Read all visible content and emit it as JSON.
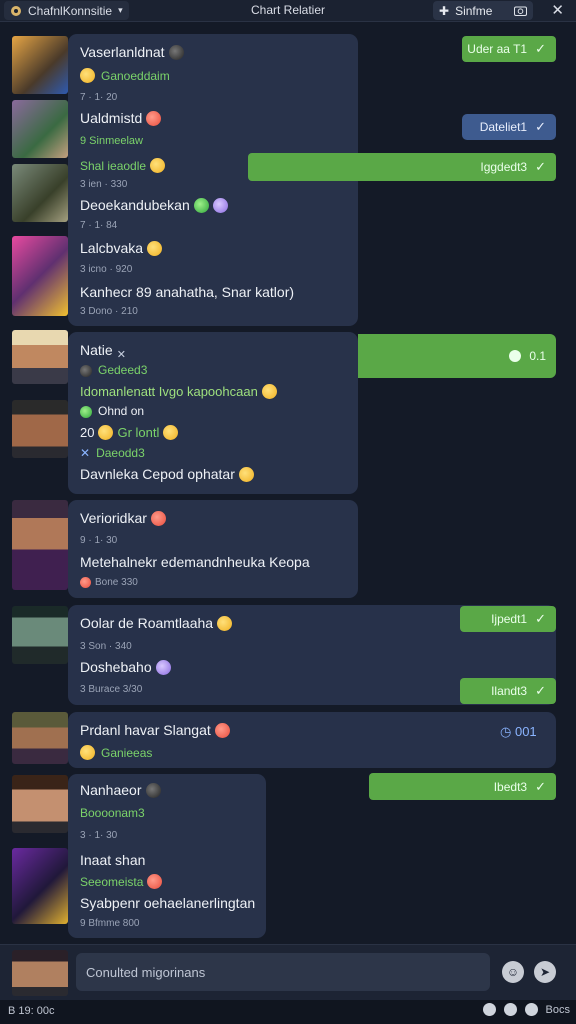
{
  "topbar": {
    "app_name": "ChafnlKonnsitie",
    "title": "Chart Relatier",
    "status_label": "Sinfme"
  },
  "messages": [
    {
      "name": "Vaserlanldnat",
      "sub": "Ganoeddaim",
      "time": "7 · 1· 20"
    },
    {
      "name": "Ualdmistd",
      "sub": "9 Sinmeelaw",
      "time": "Shal ieaodle"
    },
    {
      "name": "Deoekandubekan",
      "sub": "",
      "time": "3 ien · 330"
    },
    {
      "name": "Lalcbvaka",
      "sub": "",
      "time": "3 icno · 920"
    },
    {
      "name": "Kanhecr 89 anahatha, Snar katlor)",
      "sub": "",
      "time": "3 Dono · 210"
    },
    {
      "name": "Natie",
      "sub": "Gedeed3",
      "time": ""
    },
    {
      "name": "Idomanlenatt Ivgo kapoohcaan",
      "sub": "",
      "time": ""
    },
    {
      "name": "Ohnd on",
      "sub": "",
      "time": ""
    },
    {
      "name": "20",
      "sub": "Gr lontl",
      "time": ""
    },
    {
      "name": "Daeodd3",
      "sub": "",
      "time": ""
    },
    {
      "name": "Davnleka Cepod ophatar",
      "sub": "",
      "time": ""
    },
    {
      "name": "Verioridkar",
      "sub": "",
      "time": "9 · 1· 30"
    },
    {
      "name": "Metehalnekr edemandnheuka Keopa",
      "sub": "",
      "time": "Bone 330"
    },
    {
      "name": "Oolar de Roamtlaaha",
      "sub": "",
      "time": ""
    },
    {
      "name": "Doshebaho",
      "sub": "",
      "time": "3 Son · 340"
    },
    {
      "name": "",
      "sub": "",
      "time": "3 Burace 3/30"
    },
    {
      "name": "Prdanl havar Slangat",
      "sub": "Ganieeas",
      "time": ""
    },
    {
      "name": "Nanhaeor",
      "sub": "Boooonam3",
      "time": "3 · 1· 30"
    },
    {
      "name": "Inaat shan",
      "sub": "Seeomeista",
      "time": ""
    },
    {
      "name": "Syabpenr oehaelanerlingtan",
      "sub": "",
      "time": "9 Bfmme 800"
    }
  ],
  "replies": {
    "r1": "Uder aa T1",
    "r2": "Dateliet1",
    "r3": "Iggdedt3",
    "r4": "0.1",
    "r5": "Ijpedt1",
    "r6": "Ilandt3",
    "r7": "001",
    "r8": "Ibedt3"
  },
  "composer": {
    "placeholder": "Conulted migorinans"
  },
  "statusbar": {
    "left": "B 19: 00c",
    "right": "Bocs"
  }
}
